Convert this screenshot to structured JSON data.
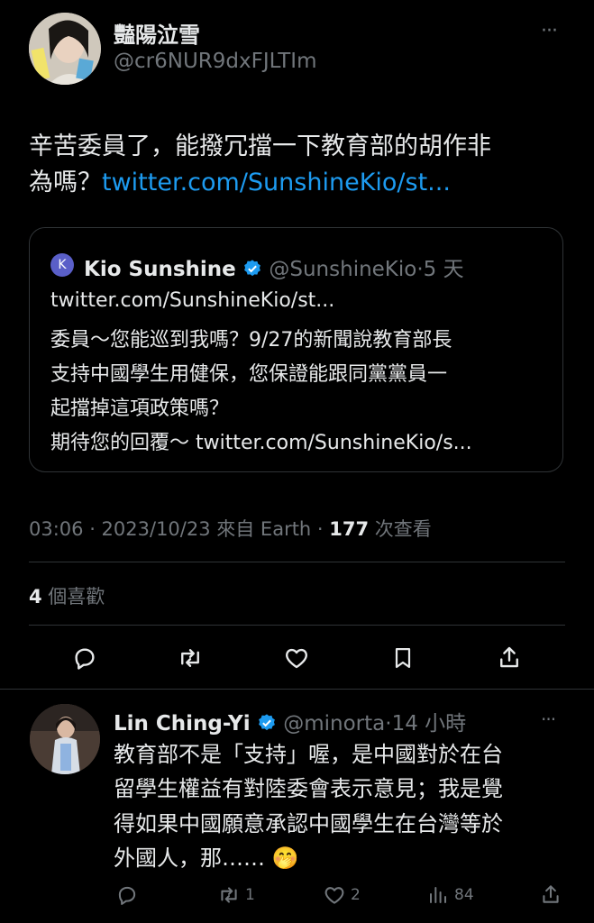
{
  "tweet": {
    "author_name": "豔陽泣雪",
    "author_handle": "@cr6NUR9dxFJLTIm",
    "more_label": "···",
    "text_line1": "辛苦委員了，能撥冗擋一下教育部的胡作非",
    "text_line2_prefix": "為嗎？",
    "text_link": "twitter.com/SunshineKio/st...",
    "quote": {
      "avatar_letter": "K",
      "name": "Kio Sunshine",
      "handle": "@SunshineKio",
      "sep": "·",
      "time": "5 天",
      "line1": "twitter.com/SunshineKio/st...",
      "line2": "委員～您能巡到我嗎？9/27的新聞說教育部長",
      "line3": "支持中國學生用健保，您保證能跟同黨黨員一",
      "line4": "起擋掉這項政策嗎？",
      "line5_prefix": "期待您的回覆～ ",
      "line5_link": "twitter.com/SunshineKio/s..."
    },
    "meta_time": "03:06 · 2023/10/23 來自 Earth · ",
    "views_count": "177",
    "views_label": " 次查看",
    "likes_count": "4",
    "likes_label": " 個喜歡"
  },
  "reply": {
    "name": "Lin Ching-Yi",
    "handle": "@minorta",
    "sep": "·",
    "time": "14 小時",
    "more_label": "···",
    "line1": "教育部不是「支持」喔，是中國對於在台",
    "line2": "留學生權益有對陸委會表示意見；我是覺",
    "line3": "得如果中國願意承認中國學生在台灣等於",
    "line4": "外國人，那…… ",
    "emoji": "🤭",
    "retweets": "1",
    "likes": "2",
    "views": "84"
  },
  "colors": {
    "accent": "#1d9bf0",
    "muted": "#71767b",
    "background": "#000000",
    "text": "#e7e9ea"
  },
  "icons": [
    "reply-icon",
    "retweet-icon",
    "like-icon",
    "bookmark-icon",
    "share-icon",
    "verified-badge-icon",
    "views-icon",
    "more-icon"
  ]
}
